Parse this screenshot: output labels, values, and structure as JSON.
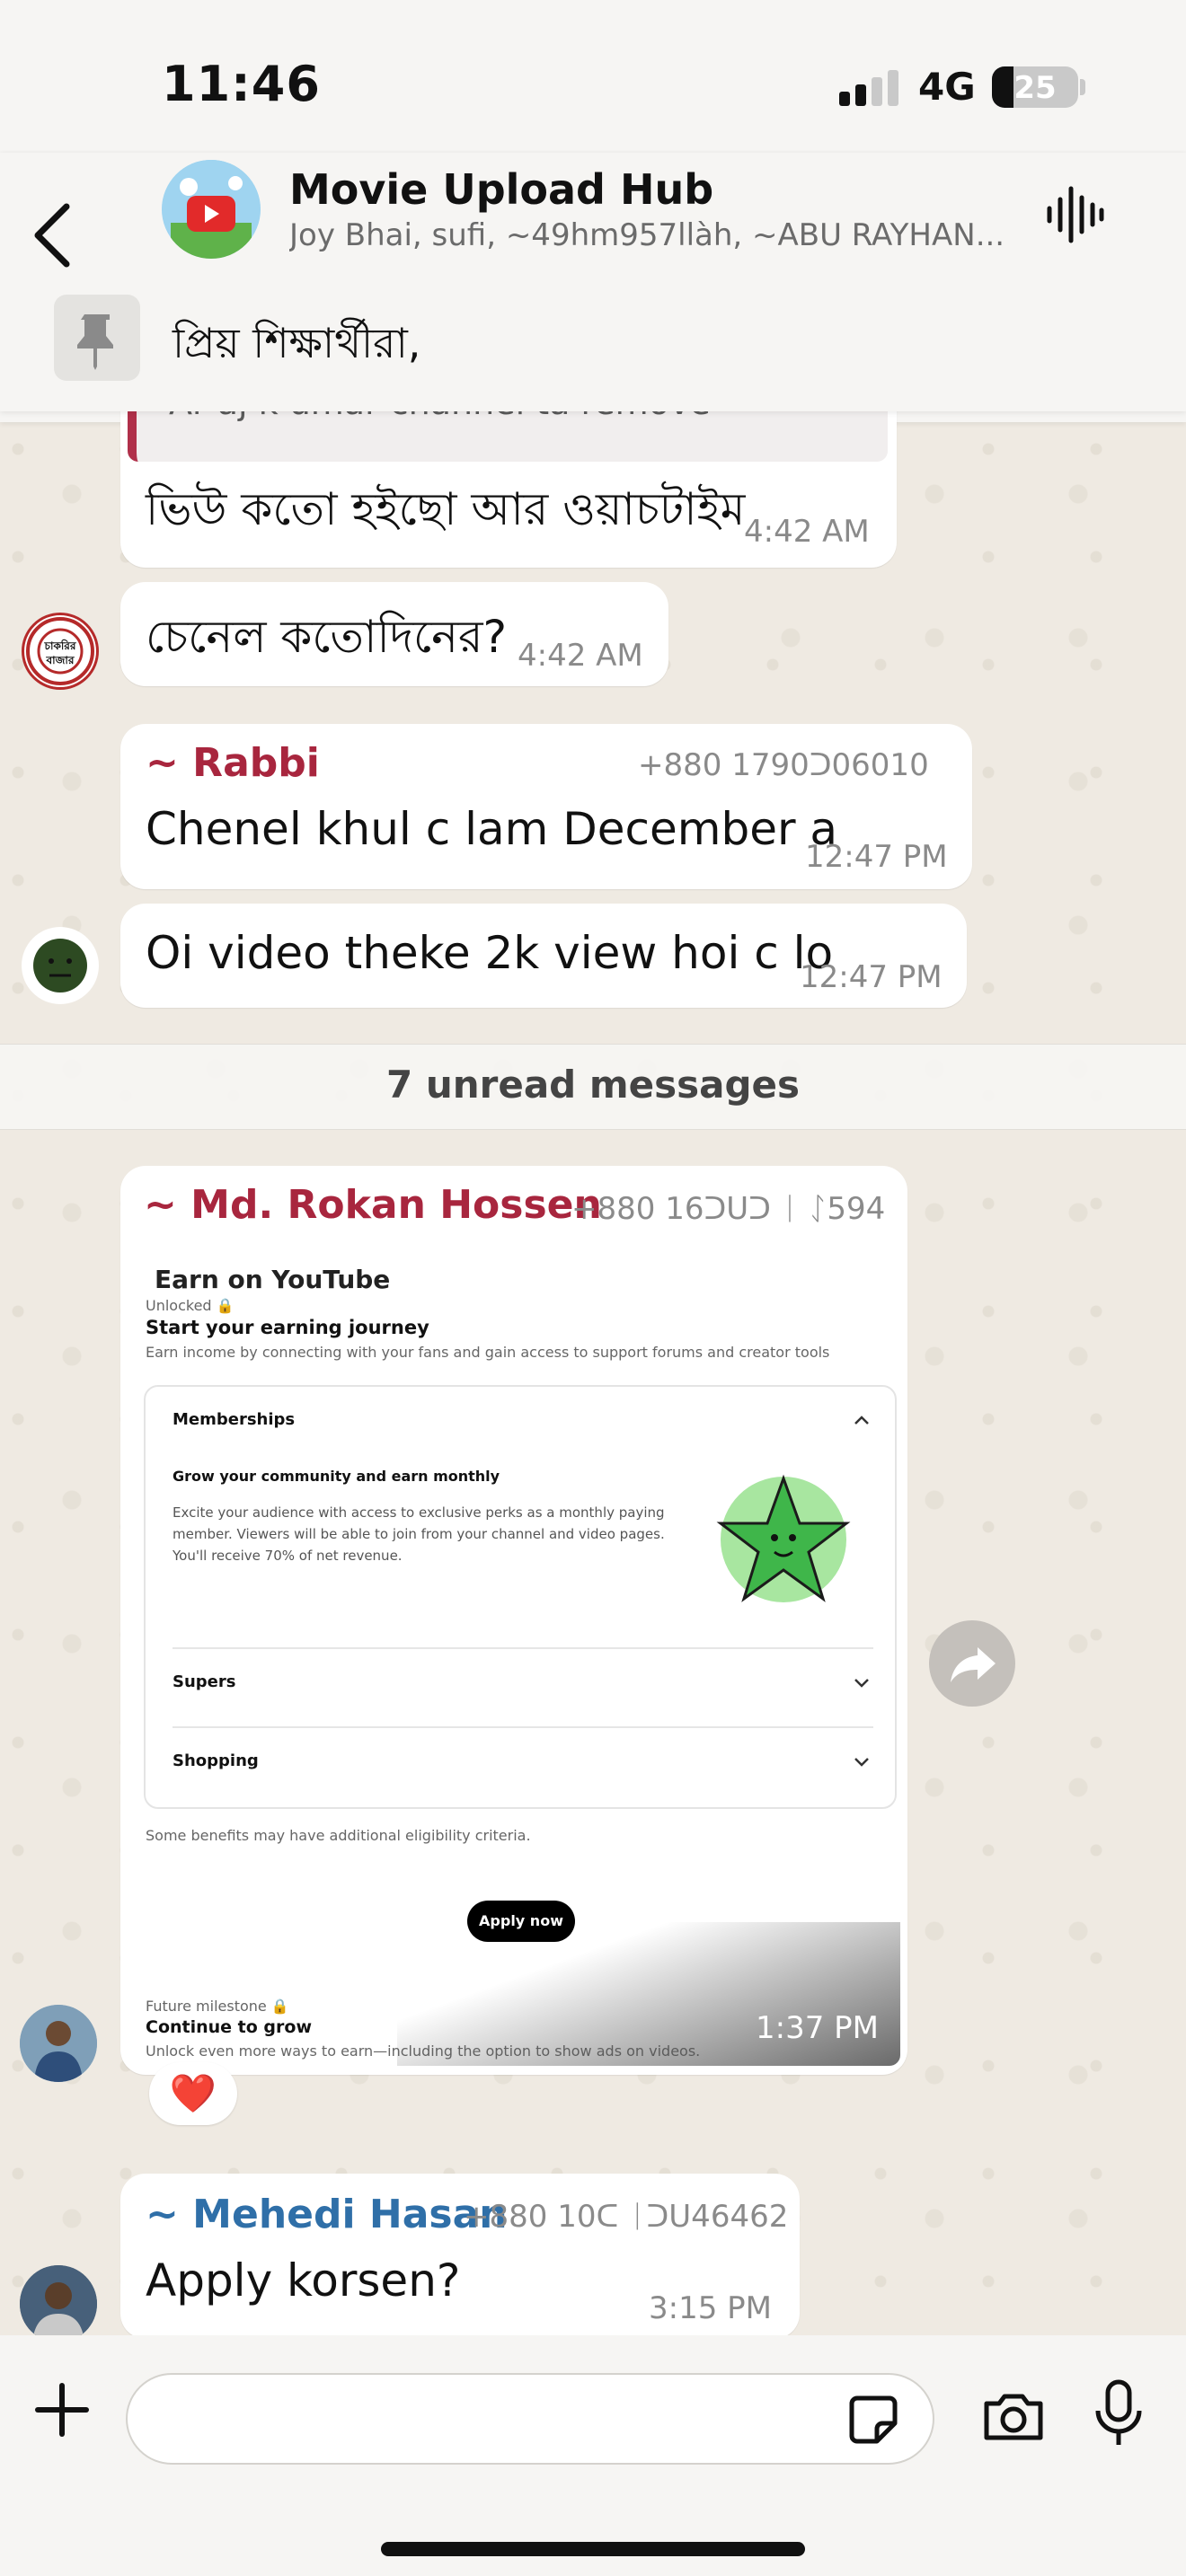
{
  "status_bar": {
    "time": "11:46",
    "network": "4G",
    "battery": "25",
    "battery_level": 0.25
  },
  "header": {
    "title": "Movie Upload Hub",
    "members": "Joy Bhai, sufi, ~49hm957llàh, ~ABU RAYHAN...",
    "back_icon": "chevron-left-icon",
    "voice_icon": "audio-wave-icon",
    "avatar_text": "YouTube"
  },
  "pinned": {
    "icon": "pin-icon",
    "text": "প্রিয় শিক্ষার্থীরা,"
  },
  "messages": [
    {
      "quote": "Ar aj k umar channel ta remove",
      "text": "ভিউ কতো হইছো আর ওয়াচটাইম",
      "time": "4:42 AM"
    },
    {
      "avatar_text": "চাকরির বাজার",
      "text": "চেনেল কতোদিনের?",
      "time": "4:42 AM"
    },
    {
      "sender": "~ Rabbi",
      "phone": "+880 1790ᑐ06010",
      "text": "Chenel khul c lam December a",
      "time": "12:47 PM"
    },
    {
      "text": "Oi video theke 2k view hoi c lo",
      "time": "12:47 PM"
    }
  ],
  "unread": "7 unread messages",
  "image_message": {
    "sender": "~ Md. Rokan Hossen",
    "phone": "+880 16ᑐᑌᑐ ᛁ ᛇ594",
    "time": "1:37 PM",
    "reaction": "❤️",
    "screenshot": {
      "title": "Earn on YouTube",
      "unlocked": "Unlocked",
      "journey_title": "Start your earning journey",
      "journey_desc": "Earn income by connecting with your fans and gain access to support forums and creator tools",
      "memberships": "Memberships",
      "mem_heading": "Grow your community and earn monthly",
      "mem_desc": "Excite your audience with access to exclusive perks as a monthly paying member. Viewers will be able to join from your channel and video pages. You'll receive 70% of net revenue.",
      "supers": "Supers",
      "shopping": "Shopping",
      "eligibility": "Some benefits may have additional eligibility criteria.",
      "apply": "Apply now",
      "future": "Future milestone",
      "continue_title": "Continue to grow",
      "continue_desc": "Unlock even more ways to earn—including the option to show ads on videos."
    }
  },
  "last_message": {
    "sender": "~ Mehedi Hasan",
    "phone": "+880 10ᑕ ᛁᑐᑌ46462",
    "text": "Apply korsen?",
    "time": "3:15 PM"
  },
  "input": {
    "placeholder": "",
    "value": ""
  },
  "colors": {
    "rabbi": "#a8263e",
    "rokan": "#a8263e",
    "mehedi": "#2f6fa8",
    "background": "#efeae2"
  }
}
